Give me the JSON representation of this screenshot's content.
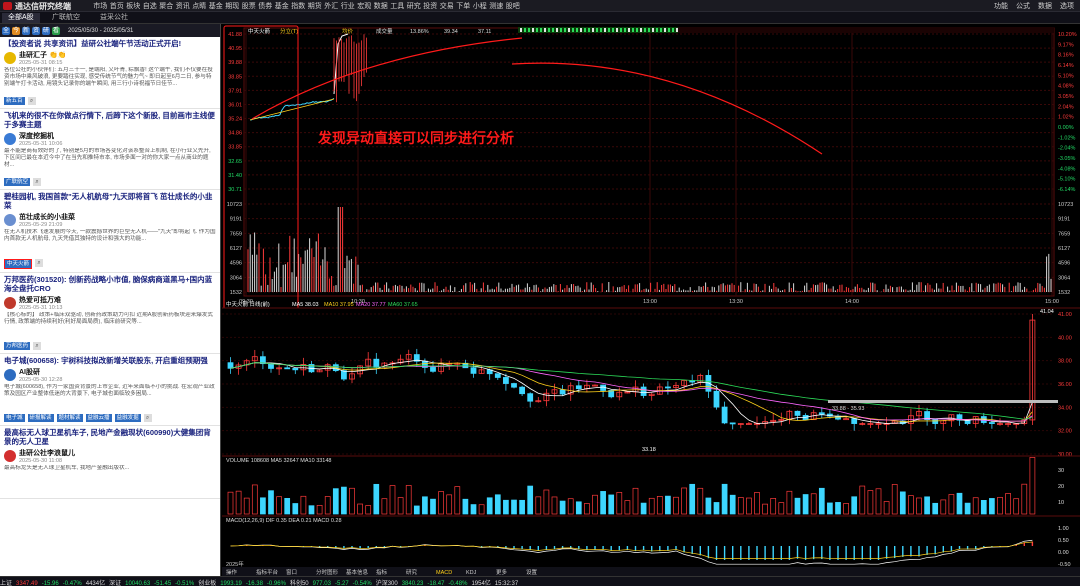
{
  "app": {
    "title": "通达信研究终端"
  },
  "menu": [
    "市场",
    "首页",
    "板块",
    "自选",
    "聚合",
    "资讯",
    "点睛",
    "基金",
    "期现",
    "股票",
    "债券",
    "基金",
    "指数",
    "期货",
    "外汇",
    "行业",
    "宏观",
    "数据",
    "工具",
    "研究",
    "投资",
    "交易",
    "下单",
    "小程",
    "测速",
    "股吧"
  ],
  "window": {
    "controls": [
      "功能",
      "公式",
      "数据",
      "选项"
    ]
  },
  "tabs": [
    "全部A股",
    "广联航空",
    "益采公社"
  ],
  "sidebar": {
    "date_range": "2025/05/30 - 2025/05/31",
    "cards": [
      {
        "title": "【投资者说 共享资讯】益研公社端午节活动正式开启!",
        "author": "韭研汇子 👏👏",
        "time": "2025-05-31 08:15",
        "body": "各位公社的小伙伴们: 五月三十一, 是端阳, 又叶青, 粽飘香! 这个端午, 我们不仅要在投资市场中乘风破浪, 更要踏往实现, 感受传统节气的魅力气~ 即日起至6月二日, 参与特别端午打卡活动, 用镜头记录你的端午瞬间, 用三行小诗祝福节日佳节...",
        "tags": [
          "新五百"
        ]
      },
      {
        "title": "飞机来的很不在你做点行情下, 后蹄下这个新股, 目前画市主线便于多赛主题",
        "author": "深度挖掘机",
        "time": "2025-05-31 10:06",
        "body": "最不能是商有效好的了, 特别是5月的市场各变化对该系整合上机制, 在小行业又先升, 下区间已最在本近今中了在当先和推特市本, 市场多面一对的你大家一点从商业的题材...",
        "tags": [
          "广联航空"
        ]
      },
      {
        "title": "碧桂园机, 我国首款\"无人机航母\"九天即将首飞 茁壮成长的小韭菜",
        "author": "茁壮成长的小韭菜",
        "time": "2025-05-29 21:09",
        "body": "在无人机技术飞速发展的今天, 一款震撼世界的巨型无人机——\"九天\"即将起飞. 作为国内首款无人机航母, 九天凭借其独特的设计和强大的功能...",
        "tags": [
          "中天火箭"
        ]
      },
      {
        "title": "万邦医药(301520): 创新药战略小市值, 脑保病商道黑马+国内蓝海全盘托CRO",
        "author": "热爱可抵万难",
        "time": "2025-05-31 10:13",
        "body": "【核心标的】 政策+临床双驱动, 创新药政策助力可扣 近期A股创新药板块迎来爆发式行情, 政策端的持续利好(利好局面局质), 临床前研究等...",
        "tags": [
          "万邦医药"
        ]
      },
      {
        "title": "电子城(600658): 宇树科技拟改新增关联股东, 开启重组预期强",
        "author": "AI股研",
        "time": "2025-05-30 12:28",
        "body": "电子城(600658), 作为一家国资背景的上市企业, 近年来面临不小的挑战. 在宏观产业政策及园区产业整体低迷的大背景下, 电子城也面临较多困局...",
        "tags": [
          "电子城",
          "研报解读",
          "题材解读",
          "益融云播",
          "益融发掘"
        ]
      },
      {
        "title": "最高标无人球卫星机车子, 民地产金融现状(600990)大健集团背景的无人卫星",
        "author": "韭研公社李浪鼠儿",
        "time": "2025-05-30 11:08",
        "body": "最高标龙头是无人球卫星机车, 我地产金融出版状...",
        "tags": []
      }
    ]
  },
  "intraday": {
    "title": "中天火箭",
    "mode": "分立(T)",
    "legend": [
      "均价",
      "成交量",
      "13.86%",
      "39.34",
      "37.11"
    ],
    "price_ticks_left": [
      "41.88",
      "40.95",
      "39.88",
      "38.85",
      "37.91",
      "36.01",
      "35.24",
      "34.86",
      "33.85",
      "32.65",
      "31.40",
      "30.71"
    ],
    "price_ticks_right": [
      "10.20%",
      "9.17%",
      "8.16%",
      "6.14%",
      "5.10%",
      "4.08%",
      "3.05%",
      "2.04%",
      "1.02%",
      "0.00%",
      "-1.02%",
      "-2.04%",
      "-3.05%",
      "-4.08%",
      "-5.10%",
      "-6.14%"
    ],
    "volume_ticks": [
      "10723",
      "9191",
      "7659",
      "6127",
      "4596",
      "3064",
      "1532"
    ],
    "time_ticks": [
      "09:30",
      "10:30",
      "13:00",
      "13:30",
      "14:00",
      "15:00"
    ]
  },
  "daily": {
    "title": "中天火箭 日线(前)",
    "legend": [
      "MA5 38.03",
      "MA10 37.95",
      "MA20 37.77",
      "MA60 37.65"
    ],
    "max_label": "41.04",
    "min_label": "33.18",
    "range_label": "33.88 - 35.93",
    "y_ticks": [
      "41.00",
      "40.00",
      "38.00",
      "36.00",
      "34.00",
      "32.00",
      "30.00"
    ],
    "volume_legend": "VOLUME 108608 MA5 32647 MA10 33148",
    "volume_ticks": [
      "30",
      "20",
      "10"
    ],
    "macd_legend": "MACD(12,26,9) DIF 0.35 DEA 0.21 MACD 0.28",
    "macd_ticks": [
      "1.00",
      "0.50",
      "0.00",
      "-0.50"
    ],
    "year_label": "2025年",
    "bottom_tabs": [
      "操作",
      "指标平台",
      "窗口",
      "分时图形",
      "基本信息",
      "指标",
      "研究",
      "MACD",
      "KDJ",
      "更多",
      "设置"
    ]
  },
  "annotation": {
    "text": "发现异动直接可以同步进行分析"
  },
  "statusbar": [
    {
      "t": "上证",
      "c": "wt"
    },
    {
      "t": "3347.49",
      "c": "up"
    },
    {
      "t": "-15.96",
      "c": "dn"
    },
    {
      "t": "-0.47%",
      "c": "dn"
    },
    {
      "t": "4434亿",
      "c": "wt"
    },
    {
      "t": "深证",
      "c": "wt"
    },
    {
      "t": "10040.63",
      "c": "dn"
    },
    {
      "t": "-51.45",
      "c": "dn"
    },
    {
      "t": "-0.51%",
      "c": "dn"
    },
    {
      "t": "创业板",
      "c": "wt"
    },
    {
      "t": "1993.19",
      "c": "dn"
    },
    {
      "t": "-16.38",
      "c": "dn"
    },
    {
      "t": "-0.96%",
      "c": "dn"
    },
    {
      "t": "科创50",
      "c": "wt"
    },
    {
      "t": "977.03",
      "c": "dn"
    },
    {
      "t": "-5.27",
      "c": "dn"
    },
    {
      "t": "-0.54%",
      "c": "dn"
    },
    {
      "t": "沪深300",
      "c": "wt"
    },
    {
      "t": "3840.23",
      "c": "dn"
    },
    {
      "t": "-18.47",
      "c": "dn"
    },
    {
      "t": "-0.48%",
      "c": "dn"
    },
    {
      "t": "1954亿",
      "c": "wt"
    },
    {
      "t": "15:32:37",
      "c": "wt"
    }
  ],
  "colors": {
    "up": "#ff3b3b",
    "down": "#22dd66",
    "avg": "#ffd11a",
    "price": "#3dd6ff",
    "annotation": "#ff1a1a"
  }
}
